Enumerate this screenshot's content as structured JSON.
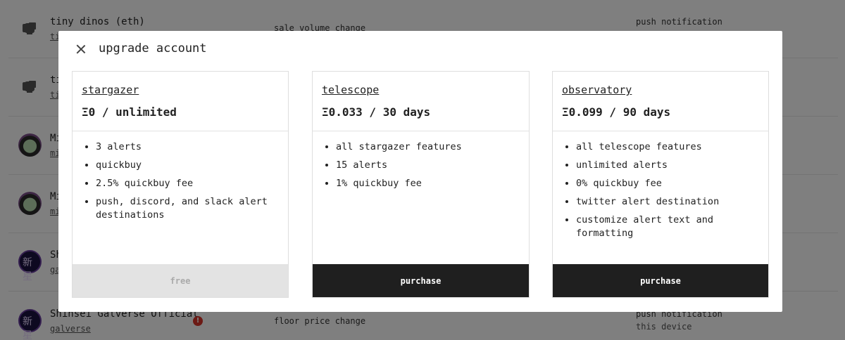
{
  "background_rows": [
    {
      "name": "tiny dinos (eth)",
      "sub": "ti",
      "avatar": "dino-avatar",
      "event": "sale volume change",
      "dest": "push notification",
      "dest_sub": ""
    },
    {
      "name": "ti",
      "sub": "ti",
      "avatar": "dino-avatar",
      "event": "",
      "dest": "",
      "dest_sub": ""
    },
    {
      "name": "Mi",
      "sub": "mi",
      "avatar": "mfer-avatar",
      "event": "",
      "dest": "",
      "dest_sub": ""
    },
    {
      "name": "Mi",
      "sub": "mi",
      "avatar": "mfer-avatar",
      "event": "",
      "dest": "",
      "dest_sub": ""
    },
    {
      "name": "Sh",
      "sub": "ga",
      "avatar": "galverse-avatar",
      "event": "",
      "dest": "",
      "dest_sub": ""
    },
    {
      "name": "Shinsei Galverse Official",
      "sub": "galverse",
      "avatar": "galverse-avatar",
      "warn": "!",
      "event": "floor price change",
      "dest": "push notification",
      "dest_sub": "this device"
    }
  ],
  "galverse_glyph": "新星",
  "modal": {
    "title": "upgrade account",
    "plans": [
      {
        "name": "stargazer",
        "price": "Ξ0 / unlimited",
        "features": [
          "3 alerts",
          "quickbuy",
          "2.5% quickbuy fee",
          "push, discord, and slack alert destinations"
        ],
        "button": "free",
        "button_state": "disabled"
      },
      {
        "name": "telescope",
        "price": "Ξ0.033 / 30 days",
        "features": [
          "all stargazer features",
          "15 alerts",
          "1% quickbuy fee"
        ],
        "button": "purchase",
        "button_state": "enabled"
      },
      {
        "name": "observatory",
        "price": "Ξ0.099 / 90 days",
        "features": [
          "all telescope features",
          "unlimited alerts",
          "0% quickbuy fee",
          "twitter alert destination",
          "customize alert text and formatting"
        ],
        "button": "purchase",
        "button_state": "enabled"
      }
    ]
  },
  "colors": {
    "overlay": "#000000",
    "button_dark": "#1f1f1f",
    "button_disabled": "#e3e3e3",
    "warn": "#d9352b"
  }
}
